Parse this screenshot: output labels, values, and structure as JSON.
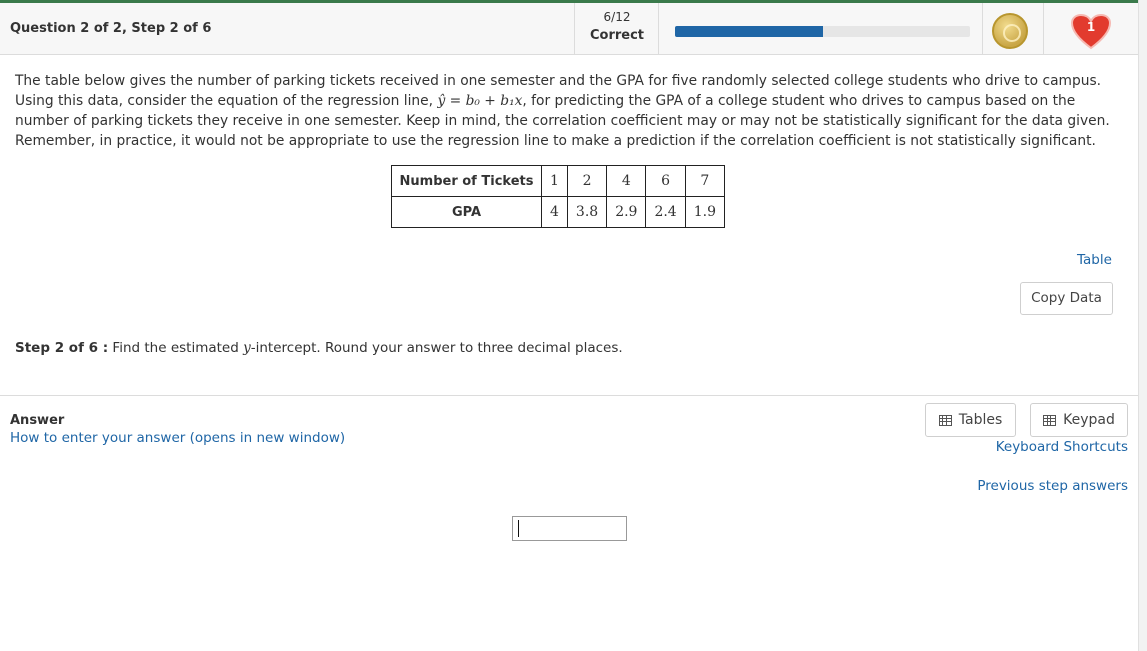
{
  "header": {
    "question_label": "Question 2 of 2, Step 2 of 6",
    "score_fraction": "6/12",
    "score_status": "Correct",
    "progress_fraction": 0.5,
    "lives_count": "1"
  },
  "problem": {
    "text_before": "The table below gives the number of parking tickets received in one semester and the GPA for five randomly selected college students who drive to campus. Using this data, consider the equation of the regression line, ",
    "equation": "ŷ = b₀ + b₁x",
    "text_after": ", for predicting the GPA of a college student who drives to campus based on the number of parking tickets they receive in one semester. Keep in mind, the correlation coefficient may or may not be statistically significant for the data given. Remember, in practice, it would not be appropriate to use the regression line to make a prediction if the correlation coefficient is not statistically significant."
  },
  "table": {
    "rows": [
      {
        "header": "Number of Tickets",
        "values": [
          "1",
          "2",
          "4",
          "6",
          "7"
        ]
      },
      {
        "header": "GPA",
        "values": [
          "4",
          "3.8",
          "2.9",
          "2.4",
          "1.9"
        ]
      }
    ]
  },
  "links": {
    "table": "Table",
    "copy_data": "Copy Data",
    "how_to": "How to enter your answer (opens in new window)",
    "keyboard_shortcuts": "Keyboard Shortcuts",
    "previous_answers": "Previous step answers"
  },
  "step": {
    "label": "Step 2 of 6 :",
    "text_before": " Find the estimated ",
    "var": "y",
    "text_after": "-intercept. Round your answer to three decimal places."
  },
  "answer": {
    "label": "Answer",
    "value": ""
  },
  "tools": {
    "tables": "Tables",
    "keypad": "Keypad"
  },
  "colors": {
    "accent": "#1f66a6",
    "progress_track": "#e6e6e6",
    "heart": "#e23b2e"
  }
}
